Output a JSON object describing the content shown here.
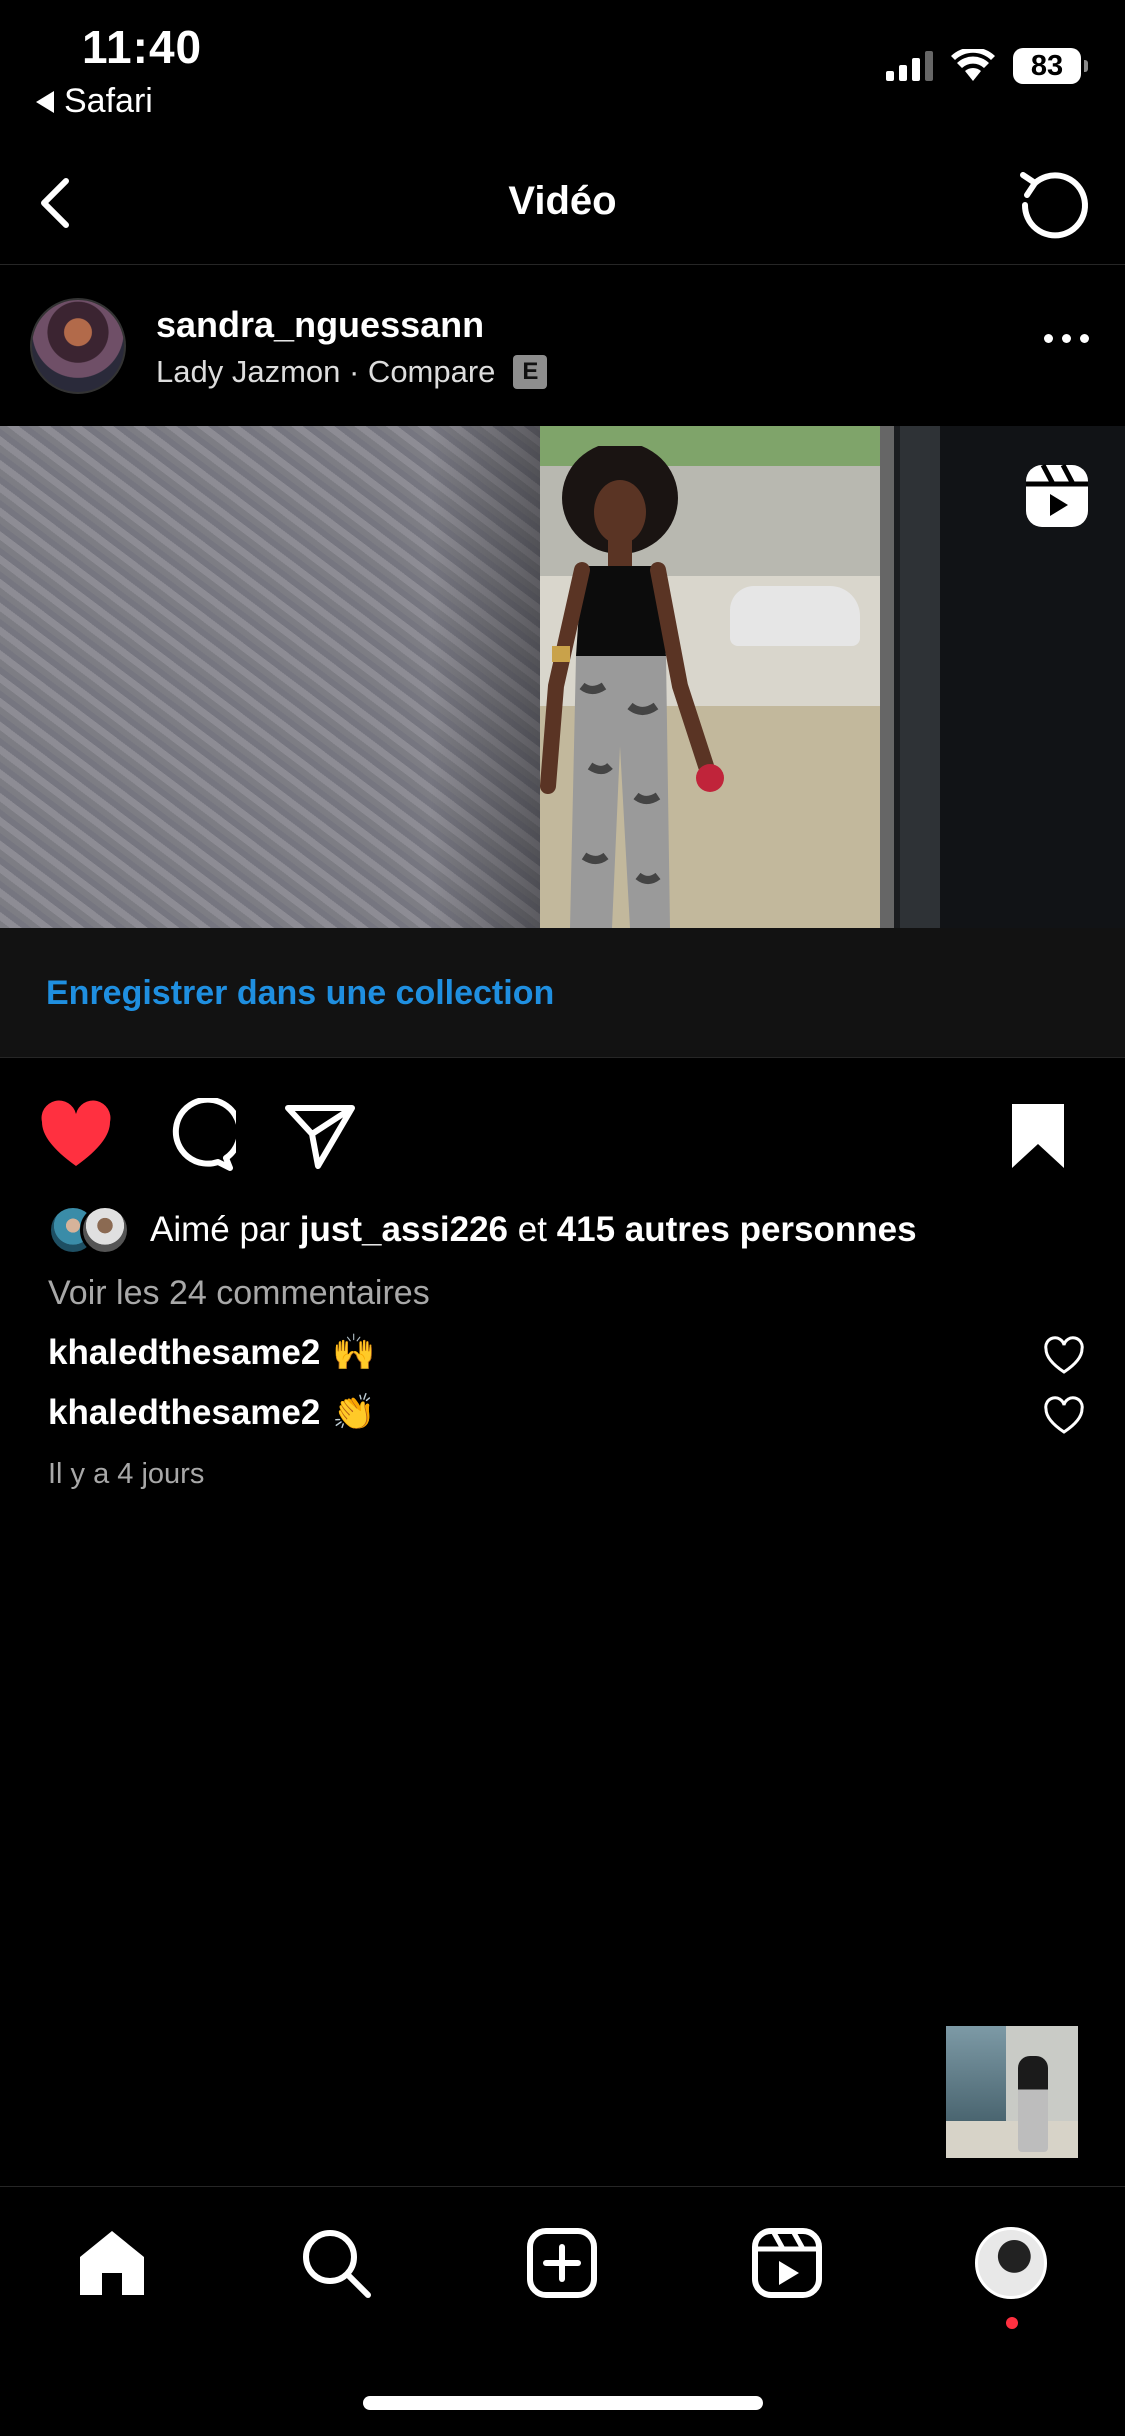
{
  "status_bar": {
    "time": "11:40",
    "back_app": "Safari",
    "battery": "83"
  },
  "header": {
    "title": "Vidéo"
  },
  "post": {
    "username": "sandra_nguessann",
    "audio_line": "Lady Jazmon · Compare",
    "explicit_badge": "E"
  },
  "collection": {
    "label": "Enregistrer dans une collection"
  },
  "likes": {
    "prefix": "Aimé par",
    "user": "just_assi226",
    "joiner": "et",
    "others": "415 autres personnes"
  },
  "view_comments": "Voir les 24 commentaires",
  "comments": [
    {
      "user": "khaledthesame2",
      "text": "🙌"
    },
    {
      "user": "khaledthesame2",
      "text": "👏"
    }
  ],
  "timestamp": "Il y a 4 jours",
  "colors": {
    "accent_link": "#1f8fe0",
    "like_red": "#ff3040",
    "secondary_text": "#a8a8a8"
  },
  "icons": {
    "liked": "heart-filled-icon",
    "comment": "comment-bubble-icon",
    "share": "paper-plane-icon",
    "saved": "bookmark-filled-icon",
    "reels_badge": "reels-icon"
  }
}
